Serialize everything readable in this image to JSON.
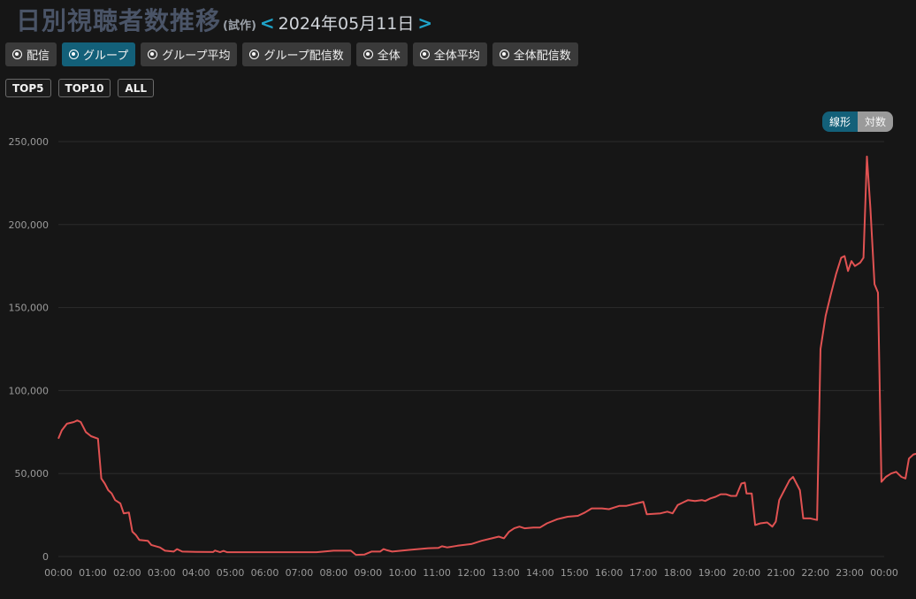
{
  "header": {
    "title": "日別視聴者数推移",
    "subtitle": "(試作)",
    "prev": "<",
    "date": "2024年05月11日",
    "next": ">"
  },
  "view_options": [
    {
      "label": "配信",
      "active": false
    },
    {
      "label": "グループ",
      "active": true
    },
    {
      "label": "グループ平均",
      "active": false
    },
    {
      "label": "グループ配信数",
      "active": false
    },
    {
      "label": "全体",
      "active": false
    },
    {
      "label": "全体平均",
      "active": false
    },
    {
      "label": "全体配信数",
      "active": false
    }
  ],
  "top_filters": [
    "TOP5",
    "TOP10",
    "ALL"
  ],
  "scale_toggle": {
    "linear": "線形",
    "log": "対数",
    "selected": "線形"
  },
  "colors": {
    "line": "#e05252",
    "accent": "#136079",
    "title": "#4a5467",
    "nav": "#1fa3c9"
  },
  "chart_data": {
    "type": "line",
    "x_unit": "time of day (hours)",
    "xlim": [
      0,
      24
    ],
    "ylim": [
      0,
      250000
    ],
    "y_ticks": [
      0,
      50000,
      100000,
      150000,
      200000,
      250000
    ],
    "y_tick_labels": [
      "0",
      "50,000",
      "100,000",
      "150,000",
      "200,000",
      "250,000"
    ],
    "x_ticks": [
      0,
      1,
      2,
      3,
      4,
      5,
      6,
      7,
      8,
      9,
      10,
      11,
      12,
      13,
      14,
      15,
      16,
      17,
      18,
      19,
      20,
      21,
      22,
      23,
      24
    ],
    "x_tick_labels": [
      "00:00",
      "01:00",
      "02:00",
      "03:00",
      "04:00",
      "05:00",
      "06:00",
      "07:00",
      "08:00",
      "09:00",
      "10:00",
      "11:00",
      "12:00",
      "13:00",
      "14:00",
      "15:00",
      "16:00",
      "17:00",
      "18:00",
      "19:00",
      "20:00",
      "21:00",
      "22:00",
      "23:00",
      "00:00"
    ],
    "grid": true,
    "series": [
      {
        "points": [
          [
            0.0,
            71000
          ],
          [
            0.1,
            76000
          ],
          [
            0.25,
            80000
          ],
          [
            0.45,
            81000
          ],
          [
            0.55,
            82000
          ],
          [
            0.65,
            81000
          ],
          [
            0.8,
            75000
          ],
          [
            0.95,
            72500
          ],
          [
            1.15,
            71000
          ],
          [
            1.25,
            47000
          ],
          [
            1.35,
            44000
          ],
          [
            1.45,
            40000
          ],
          [
            1.55,
            38000
          ],
          [
            1.65,
            34000
          ],
          [
            1.8,
            32000
          ],
          [
            1.9,
            26000
          ],
          [
            2.05,
            26500
          ],
          [
            2.15,
            15000
          ],
          [
            2.25,
            13000
          ],
          [
            2.35,
            10000
          ],
          [
            2.6,
            9500
          ],
          [
            2.7,
            7000
          ],
          [
            2.95,
            5500
          ],
          [
            3.1,
            3500
          ],
          [
            3.35,
            3000
          ],
          [
            3.45,
            4500
          ],
          [
            3.6,
            3000
          ],
          [
            4.0,
            2800
          ],
          [
            4.5,
            2700
          ],
          [
            4.55,
            3600
          ],
          [
            4.7,
            2600
          ],
          [
            4.8,
            3400
          ],
          [
            4.9,
            2600
          ],
          [
            6.0,
            2600
          ],
          [
            7.0,
            2600
          ],
          [
            7.5,
            2600
          ],
          [
            8.0,
            3500
          ],
          [
            8.5,
            3500
          ],
          [
            8.65,
            1000
          ],
          [
            8.9,
            1200
          ],
          [
            9.1,
            3000
          ],
          [
            9.35,
            3000
          ],
          [
            9.45,
            4500
          ],
          [
            9.55,
            3800
          ],
          [
            9.7,
            3000
          ],
          [
            9.9,
            3400
          ],
          [
            10.2,
            4000
          ],
          [
            10.45,
            4500
          ],
          [
            10.75,
            5000
          ],
          [
            11.05,
            5200
          ],
          [
            11.15,
            6200
          ],
          [
            11.3,
            5500
          ],
          [
            11.6,
            6500
          ],
          [
            12.0,
            7500
          ],
          [
            12.3,
            9500
          ],
          [
            12.6,
            11000
          ],
          [
            12.8,
            12000
          ],
          [
            12.95,
            11000
          ],
          [
            13.1,
            15000
          ],
          [
            13.25,
            17000
          ],
          [
            13.4,
            18000
          ],
          [
            13.55,
            17000
          ],
          [
            13.8,
            17500
          ],
          [
            14.0,
            17500
          ],
          [
            14.2,
            20000
          ],
          [
            14.5,
            22500
          ],
          [
            14.8,
            24000
          ],
          [
            15.1,
            24500
          ],
          [
            15.3,
            26500
          ],
          [
            15.5,
            29000
          ],
          [
            15.8,
            29000
          ],
          [
            16.0,
            28500
          ],
          [
            16.3,
            30500
          ],
          [
            16.5,
            30500
          ],
          [
            16.8,
            32000
          ],
          [
            17.0,
            33000
          ],
          [
            17.1,
            25500
          ],
          [
            17.5,
            26000
          ],
          [
            17.7,
            27000
          ],
          [
            17.85,
            26000
          ],
          [
            18.0,
            31000
          ],
          [
            18.15,
            32500
          ],
          [
            18.3,
            34000
          ],
          [
            18.5,
            33500
          ],
          [
            18.7,
            34000
          ],
          [
            18.8,
            33500
          ],
          [
            18.95,
            35000
          ],
          [
            19.1,
            36000
          ],
          [
            19.25,
            37500
          ],
          [
            19.4,
            37500
          ],
          [
            19.55,
            36500
          ],
          [
            19.7,
            36500
          ],
          [
            19.85,
            44000
          ],
          [
            19.95,
            44500
          ],
          [
            20.0,
            38000
          ],
          [
            20.15,
            38000
          ],
          [
            20.25,
            19000
          ],
          [
            20.4,
            20000
          ],
          [
            20.6,
            20500
          ],
          [
            20.75,
            18000
          ],
          [
            20.85,
            21000
          ],
          [
            20.95,
            34000
          ],
          [
            21.1,
            40000
          ],
          [
            21.25,
            46000
          ],
          [
            21.35,
            48000
          ],
          [
            21.45,
            44000
          ],
          [
            21.55,
            40000
          ],
          [
            21.65,
            23000
          ],
          [
            21.85,
            23000
          ],
          [
            21.95,
            22500
          ],
          [
            22.05,
            22000
          ],
          [
            22.15,
            125000
          ],
          [
            22.3,
            145000
          ],
          [
            22.45,
            158000
          ],
          [
            22.6,
            170000
          ],
          [
            22.75,
            180000
          ],
          [
            22.85,
            181000
          ],
          [
            22.95,
            172000
          ],
          [
            23.05,
            178000
          ],
          [
            23.15,
            175000
          ],
          [
            23.3,
            177000
          ],
          [
            23.4,
            180000
          ],
          [
            23.5,
            241000
          ],
          [
            23.6,
            210000
          ],
          [
            23.72,
            164000
          ],
          [
            23.82,
            159000
          ],
          [
            23.92,
            45000
          ],
          [
            24.05,
            48000
          ],
          [
            24.2,
            50000
          ],
          [
            24.35,
            51000
          ],
          [
            24.5,
            48000
          ],
          [
            24.62,
            47000
          ],
          [
            24.72,
            59000
          ],
          [
            24.85,
            61500
          ],
          [
            24.95,
            62000
          ],
          [
            25.05,
            57000
          ],
          [
            25.15,
            57000
          ]
        ]
      }
    ]
  }
}
